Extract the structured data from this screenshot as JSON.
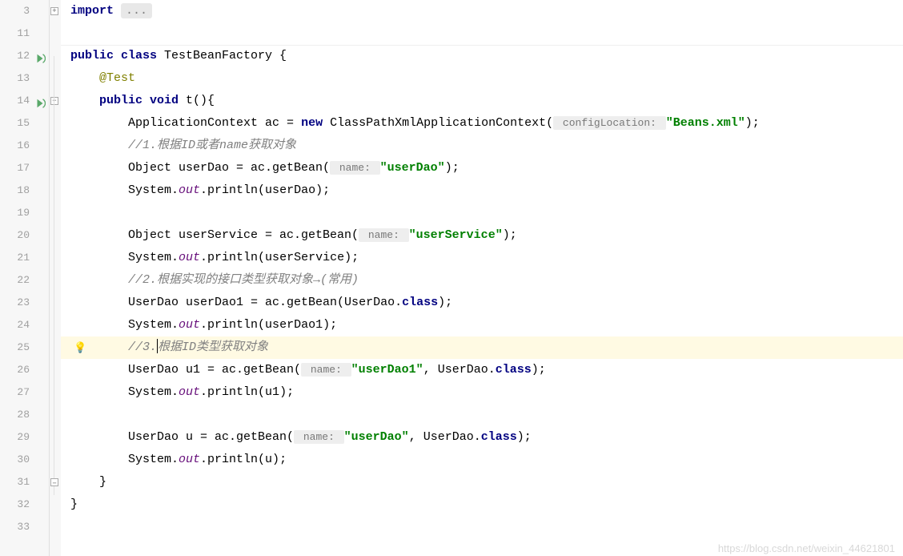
{
  "gutter": {
    "lines": [
      "3",
      "11",
      "12",
      "13",
      "14",
      "15",
      "16",
      "17",
      "18",
      "19",
      "20",
      "21",
      "22",
      "23",
      "24",
      "25",
      "26",
      "27",
      "28",
      "29",
      "30",
      "31",
      "32",
      "33"
    ]
  },
  "code": {
    "l3_import": "import ",
    "l3_folded": "...",
    "l12_public": "public class ",
    "l12_class": "TestBeanFactory {",
    "l13_anno": "@Test",
    "l14_pub": "public void ",
    "l14_method": "t(){",
    "l15_a": "ApplicationContext ac = ",
    "l15_new": "new ",
    "l15_b": "ClassPathXmlApplicationContext(",
    "l15_hint": " configLocation: ",
    "l15_str": "\"Beans.xml\"",
    "l15_c": ");",
    "l16_comment": "//1.根据ID或者name获取对象",
    "l17_a": "Object userDao = ac.getBean(",
    "l17_hint": " name: ",
    "l17_str": "\"userDao\"",
    "l17_b": ");",
    "l18_a": "System.",
    "l18_out": "out",
    "l18_b": ".println(userDao);",
    "l20_a": "Object userService = ac.getBean(",
    "l20_hint": " name: ",
    "l20_str": "\"userService\"",
    "l20_b": ");",
    "l21_a": "System.",
    "l21_out": "out",
    "l21_b": ".println(userService);",
    "l22_comment": "//2.根据实现的接口类型获取对象→(常用)",
    "l23_a": "UserDao userDao1 = ac.getBean(UserDao.",
    "l23_class": "class",
    "l23_b": ");",
    "l24_a": "System.",
    "l24_out": "out",
    "l24_b": ".println(userDao1);",
    "l25_a": "//3.",
    "l25_b": "根据ID类型获取对象",
    "l26_a": "UserDao u1 = ac.getBean(",
    "l26_hint": " name: ",
    "l26_str": "\"userDao1\"",
    "l26_b": ", UserDao.",
    "l26_class": "class",
    "l26_c": ");",
    "l27_a": "System.",
    "l27_out": "out",
    "l27_b": ".println(u1);",
    "l29_a": "UserDao u = ac.getBean(",
    "l29_hint": " name: ",
    "l29_str": "\"userDao\"",
    "l29_b": ", UserDao.",
    "l29_class": "class",
    "l29_c": ");",
    "l30_a": "System.",
    "l30_out": "out",
    "l30_b": ".println(u);",
    "l31_brace": "}",
    "l32_brace": "}"
  },
  "watermark": "https://blog.csdn.net/weixin_44621801"
}
